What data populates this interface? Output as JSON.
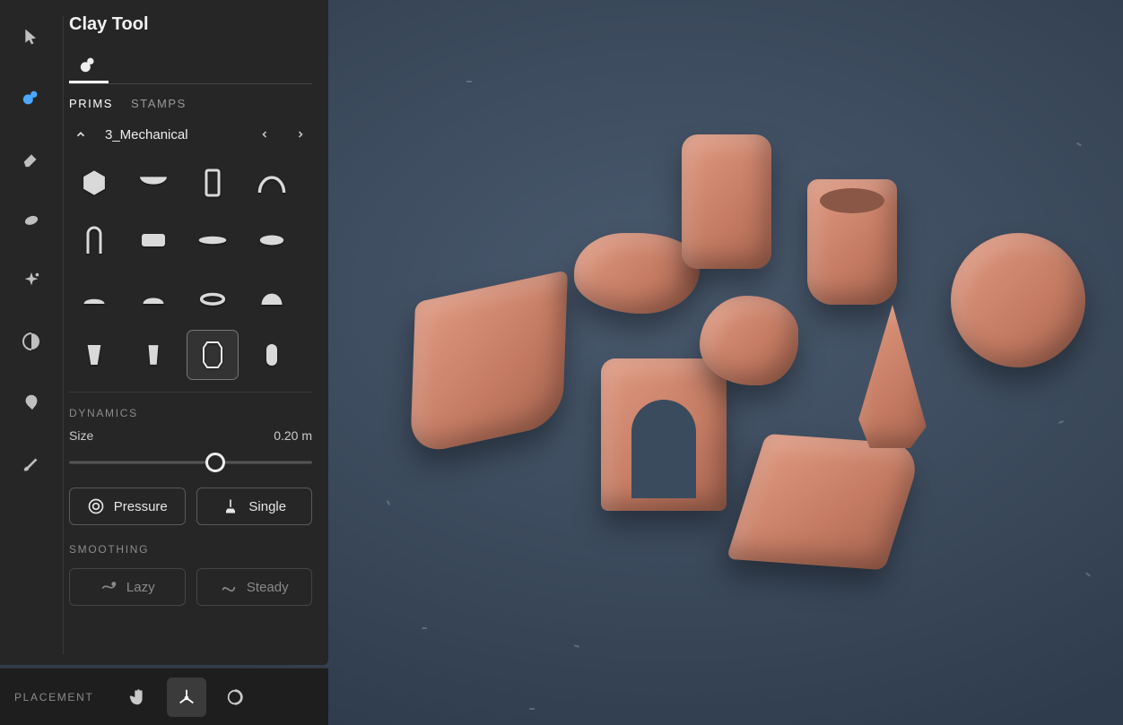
{
  "panel": {
    "title": "Clay Tool",
    "tabs": {
      "prims": "PRIMS",
      "stamps": "STAMPS",
      "active": "prims"
    },
    "category": {
      "name": "3_Mechanical"
    },
    "prims_grid": {
      "selected_index": 14,
      "count": 16
    },
    "dynamics": {
      "label": "DYNAMICS",
      "size_label": "Size",
      "size_value": "0.20 m",
      "size_fraction": 0.6,
      "pressure": "Pressure",
      "single": "Single"
    },
    "smoothing": {
      "label": "SMOOTHING",
      "lazy": "Lazy",
      "steady": "Steady"
    }
  },
  "toolrail": {
    "items": [
      {
        "name": "select-tool",
        "active": false
      },
      {
        "name": "clay-tool",
        "active": true
      },
      {
        "name": "erase-tool",
        "active": false
      },
      {
        "name": "smudge-tool",
        "active": false
      },
      {
        "name": "sparkle-tool",
        "active": false
      },
      {
        "name": "warp-tool",
        "active": false
      },
      {
        "name": "inflate-tool",
        "active": false
      },
      {
        "name": "paint-tool",
        "active": false
      }
    ]
  },
  "bottom": {
    "label": "PLACEMENT",
    "modes": [
      {
        "name": "hand-mode",
        "active": false
      },
      {
        "name": "axis-mode",
        "active": true
      },
      {
        "name": "circle-mode",
        "active": false
      }
    ]
  },
  "viewport": {
    "objects": [
      "curved-block",
      "arch",
      "wedge",
      "rock-flat",
      "rock-chunk",
      "hex-canister",
      "cup",
      "spire",
      "sphere-jar"
    ]
  }
}
